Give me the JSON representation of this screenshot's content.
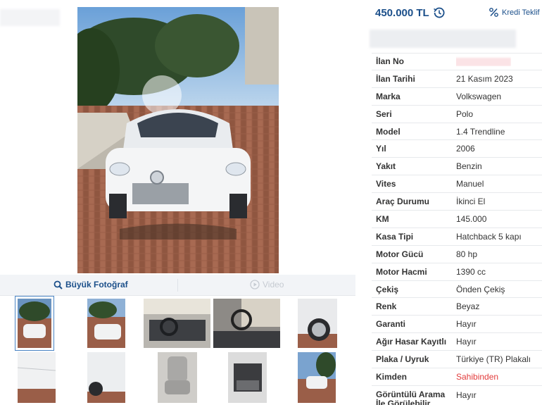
{
  "price": "450.000 TL",
  "offer_label": "Kredi Teklif",
  "gallery": {
    "big_photo_label": "Büyük Fotoğraf",
    "video_label": "Video"
  },
  "specs": [
    {
      "label": "İlan No",
      "value": ""
    },
    {
      "label": "İlan Tarihi",
      "value": "21 Kasım 2023"
    },
    {
      "label": "Marka",
      "value": "Volkswagen"
    },
    {
      "label": "Seri",
      "value": "Polo"
    },
    {
      "label": "Model",
      "value": "1.4 Trendline"
    },
    {
      "label": "Yıl",
      "value": "2006"
    },
    {
      "label": "Yakıt",
      "value": "Benzin"
    },
    {
      "label": "Vites",
      "value": "Manuel"
    },
    {
      "label": "Araç Durumu",
      "value": "İkinci El"
    },
    {
      "label": "KM",
      "value": "145.000"
    },
    {
      "label": "Kasa Tipi",
      "value": "Hatchback 5 kapı"
    },
    {
      "label": "Motor Gücü",
      "value": "80 hp"
    },
    {
      "label": "Motor Hacmi",
      "value": "1390 cc"
    },
    {
      "label": "Çekiş",
      "value": "Önden Çekiş"
    },
    {
      "label": "Renk",
      "value": "Beyaz"
    },
    {
      "label": "Garanti",
      "value": "Hayır"
    },
    {
      "label": "Ağır Hasar Kayıtlı",
      "value": "Hayır"
    },
    {
      "label": "Plaka / Uyruk",
      "value": "Türkiye (TR) Plakalı"
    },
    {
      "label": "Kimden",
      "value": "Sahibinden"
    },
    {
      "label": "Görüntülü Arama İle Görülebilir",
      "value": "Hayır"
    }
  ],
  "colors": {
    "brand_blue": "#1b4f8a",
    "seller_red": "#e23b3b"
  }
}
